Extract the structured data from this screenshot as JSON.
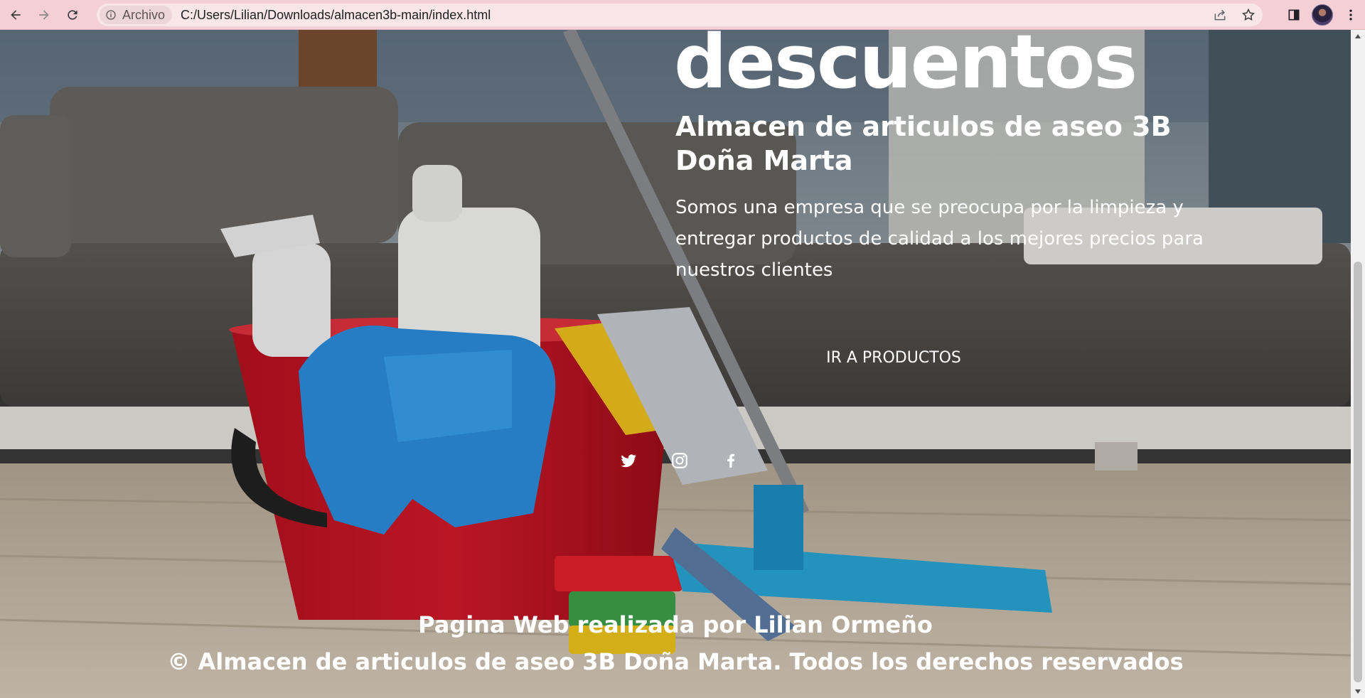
{
  "browser": {
    "site_chip": "Archivo",
    "url": "C:/Users/Lilian/Downloads/almacen3b-main/index.html"
  },
  "hero": {
    "title": "descuentos",
    "subtitle": "Almacen de articulos de aseo 3B Doña Marta",
    "description": "Somos una empresa que se preocupa por la limpieza y entregar productos de calidad a los mejores precios para nuestros clientes",
    "cta_label": "IR A PRODUCTOS"
  },
  "social": [
    "twitter-icon",
    "instagram-icon",
    "facebook-icon"
  ],
  "footer": {
    "credit": "Pagina Web realizada por Lilian Ormeño",
    "copyright": "© Almacen de articulos de aseo 3B Doña Marta. Todos los derechos reservados"
  },
  "colors": {
    "chrome_bg": "#f4cfd6",
    "text": "#ffffff"
  }
}
